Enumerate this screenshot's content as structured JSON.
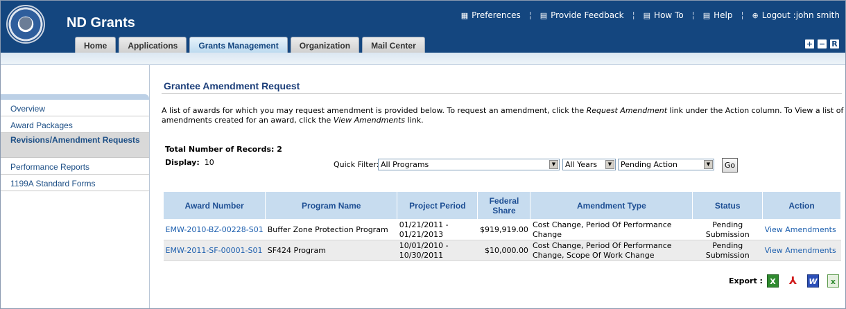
{
  "app": {
    "title": "ND Grants"
  },
  "toplinks": [
    {
      "label": "Preferences",
      "icon": "preferences-icon"
    },
    {
      "label": "Provide Feedback",
      "icon": "feedback-icon"
    },
    {
      "label": "How To",
      "icon": "howto-icon"
    },
    {
      "label": "Help",
      "icon": "help-icon"
    },
    {
      "label": "Logout :john smith",
      "icon": "logout-icon"
    }
  ],
  "tabs": [
    "Home",
    "Applications",
    "Grants Management",
    "Organization",
    "Mail Center"
  ],
  "active_tab": "Grants Management",
  "window_buttons": [
    "+",
    "−",
    "R"
  ],
  "sidebar": {
    "items": [
      "Overview",
      "Award Packages",
      "Revisions/Amendment Requests",
      "Performance Reports",
      "1199A Standard Forms"
    ],
    "active": "Revisions/Amendment Requests"
  },
  "main": {
    "title": "Grantee Amendment Request",
    "intro_1": "A list of awards for which you may request amendment is provided below. To request an amendment, click the ",
    "intro_link1": "Request Amendment",
    "intro_2": " link under the Action column. To View a list of amendments created for an award, click the ",
    "intro_link2": "View Amendments",
    "intro_3": " link.",
    "total_label": "Total Number of Records: 2",
    "display_label": "Display:",
    "display_value": "10",
    "quick_filter_label": "Quick Filter:",
    "filter_program": "All Programs",
    "filter_years": "All Years",
    "filter_status": "Pending Action",
    "go_label": "Go"
  },
  "table": {
    "headers": [
      "Award Number",
      "Program Name",
      "Project Period",
      "Federal Share",
      "Amendment Type",
      "Status",
      "Action"
    ],
    "rows": [
      {
        "award_number": "EMW-2010-BZ-00228-S01",
        "program_name": "Buffer Zone Protection Program",
        "project_period": "01/21/2011 - 01/21/2013",
        "federal_share": "$919,919.00",
        "amendment_type": "Cost Change, Period Of Performance Change",
        "status": "Pending Submission",
        "action": "View Amendments"
      },
      {
        "award_number": "EMW-2011-SF-00001-S01",
        "program_name": "SF424 Program",
        "project_period": "10/01/2010 - 10/30/2011",
        "federal_share": "$10,000.00",
        "amendment_type": "Cost Change, Period Of Performance Change, Scope Of Work Change",
        "status": "Pending Submission",
        "action": "View Amendments"
      }
    ]
  },
  "export": {
    "label": "Export :",
    "formats": [
      "excel-icon",
      "pdf-icon",
      "word-icon",
      "csv-icon"
    ]
  }
}
